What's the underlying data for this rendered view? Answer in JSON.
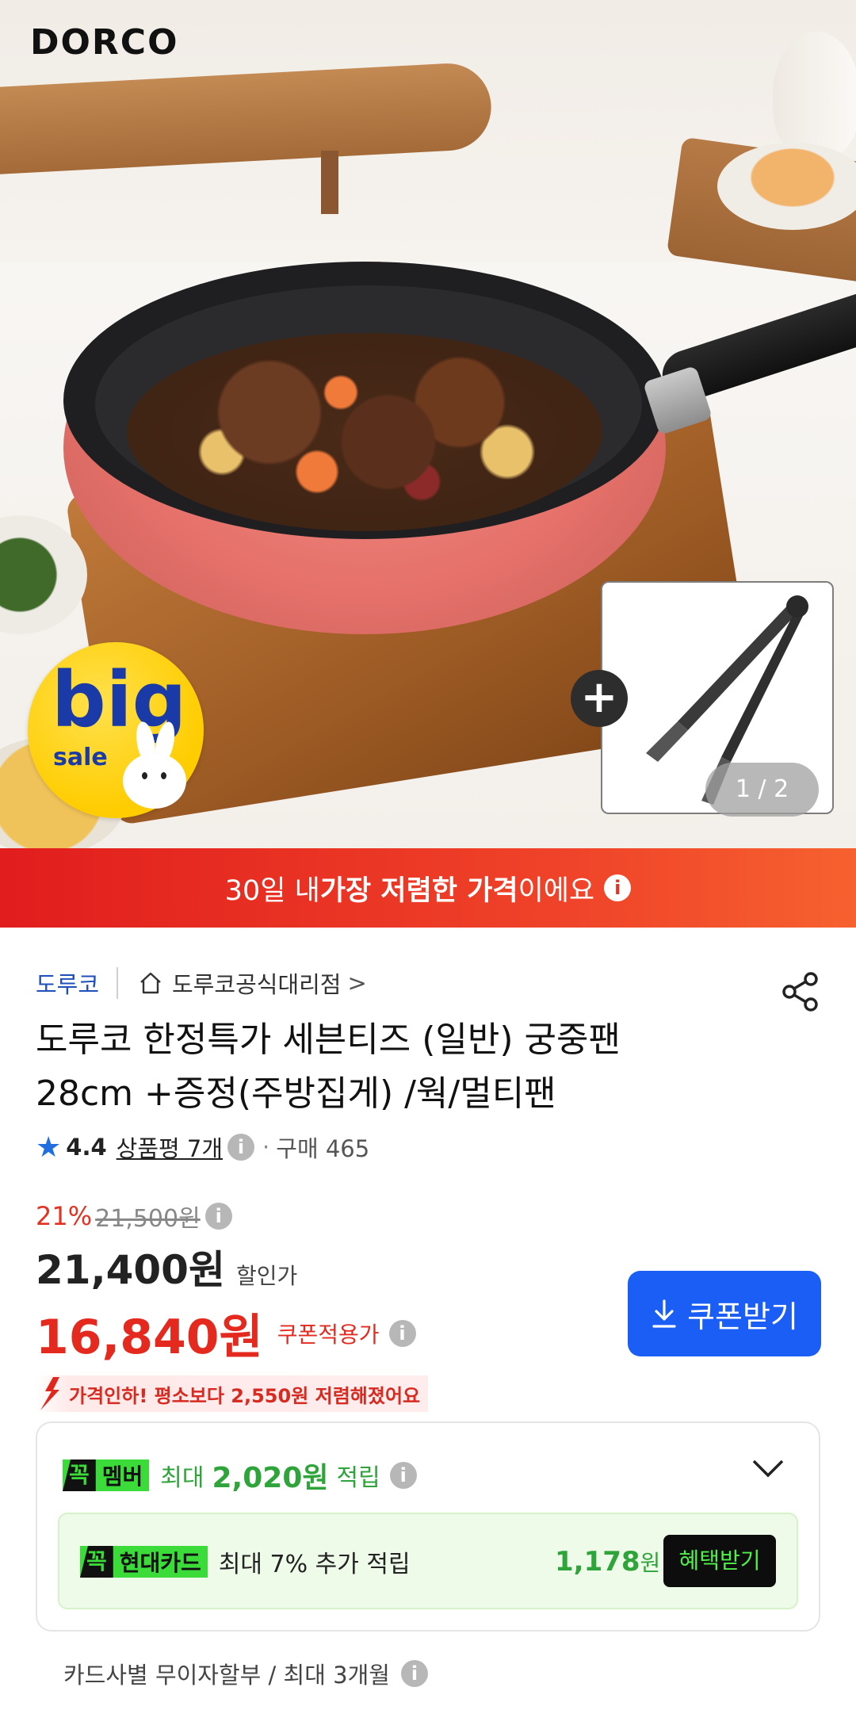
{
  "hero": {
    "logo": "DORCO",
    "badge_big": "big",
    "badge_sale": "sale",
    "image_counter": "1 / 2",
    "plus_symbol": "+"
  },
  "banner": {
    "prefix": "30일 내 ",
    "bold": "가장 저렴한 가격",
    "suffix": "이에요",
    "info_glyph": "i"
  },
  "seller": {
    "brand": "도루코",
    "store": "도루코공식대리점",
    "chevron": ">"
  },
  "product": {
    "title_line1": "도루코 한정특가 세븐티즈 (일반) 궁중팬",
    "title_line2": "28cm +증정(주방집게) /웍/멀티팬"
  },
  "rating": {
    "score": "4.4",
    "reviews": "상품평 7개",
    "purchases": "구매 465",
    "dot": "·"
  },
  "price": {
    "discount_pct": "21%",
    "original": "21,500원",
    "sale_price": "21,400원",
    "sale_label": "할인가",
    "coupon_price": "16,840원",
    "coupon_label": "쿠폰적용가",
    "drop_text": "가격인하! 평소보다 2,550원 저렴해졌어요"
  },
  "coupon_button": {
    "label": "쿠폰받기"
  },
  "member": {
    "badge_kk": "꼭",
    "badge_label": "멤버",
    "max_text": "최대",
    "amount": "2,020원",
    "accrue": "적립",
    "card_badge_label": "현대카드",
    "card_text": "최대 7% 추가 적립",
    "card_amount": "1,178",
    "card_amount_unit": "원",
    "benefit_button": "혜택받기"
  },
  "installment": {
    "text": "카드사별 무이자할부 / 최대 3개월"
  },
  "colors": {
    "accent_blue": "#1a5ef5",
    "price_red": "#e42a1f",
    "member_green": "#2ea43a",
    "badge_green": "#3bdb3a"
  }
}
